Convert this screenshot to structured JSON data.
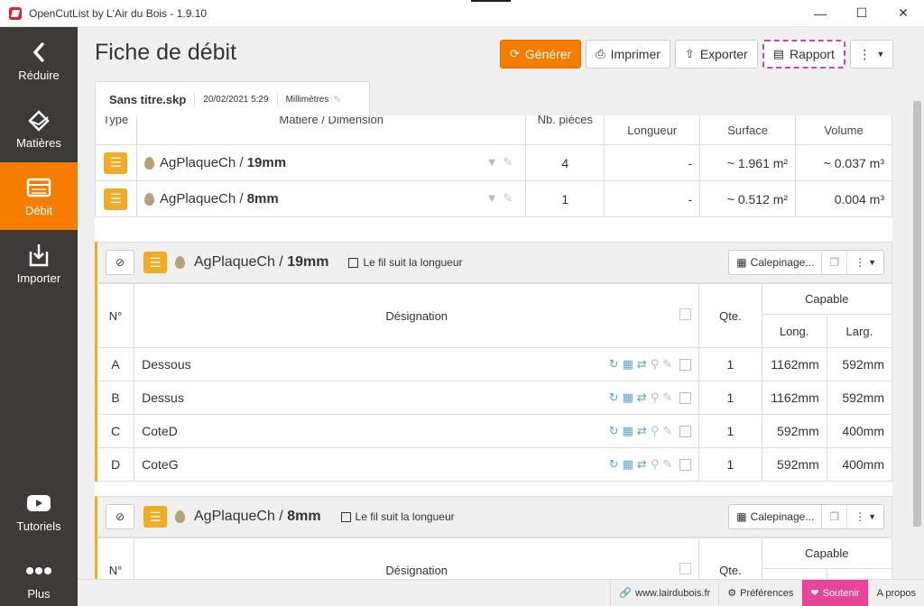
{
  "window": {
    "title": "OpenCutList by L'Air du Bois - 1.9.10"
  },
  "sidebar": {
    "items": [
      {
        "label": "Réduire"
      },
      {
        "label": "Matières"
      },
      {
        "label": "Débit"
      },
      {
        "label": "Importer"
      },
      {
        "label": "Tutoriels"
      },
      {
        "label": "Plus"
      }
    ]
  },
  "header": {
    "title": "Fiche de débit",
    "buttons": {
      "generate": "Générer",
      "print": "Imprimer",
      "export": "Exporter",
      "report": "Rapport"
    }
  },
  "file": {
    "name": "Sans titre.skp",
    "date": "20/02/2021 5:29",
    "units": "Millimètres"
  },
  "summary": {
    "headers": {
      "type": "Type",
      "material": "Matière / Dimension",
      "count": "Nb. pièces",
      "length": "Longueur",
      "surface": "Surface",
      "volume": "Volume"
    },
    "rows": [
      {
        "material": "AgPlaqueCh / ",
        "dimension": "19mm",
        "count": "4",
        "length": "-",
        "surface": "~ 1.961 m²",
        "volume": "~ 0.037 m³"
      },
      {
        "material": "AgPlaqueCh / ",
        "dimension": "8mm",
        "count": "1",
        "length": "-",
        "surface": "~ 0.512 m²",
        "volume": "0.004 m³"
      }
    ]
  },
  "groups": [
    {
      "material": "AgPlaqueCh / ",
      "dimension": "19mm",
      "grain": "Le fil suit la longueur",
      "layout_label": "Calepinage...",
      "headers": {
        "num": "N°",
        "designation": "Désignation",
        "qty": "Qte.",
        "capable": "Capable",
        "long": "Long.",
        "larg": "Larg."
      },
      "parts": [
        {
          "num": "A",
          "name": "Dessous",
          "qty": "1",
          "long": "1162mm",
          "larg": "592mm"
        },
        {
          "num": "B",
          "name": "Dessus",
          "qty": "1",
          "long": "1162mm",
          "larg": "592mm"
        },
        {
          "num": "C",
          "name": "CoteD",
          "qty": "1",
          "long": "592mm",
          "larg": "400mm"
        },
        {
          "num": "D",
          "name": "CoteG",
          "qty": "1",
          "long": "592mm",
          "larg": "400mm"
        }
      ]
    },
    {
      "material": "AgPlaqueCh / ",
      "dimension": "8mm",
      "grain": "Le fil suit la longueur",
      "layout_label": "Calepinage...",
      "headers": {
        "num": "N°",
        "designation": "Désignation",
        "qty": "Qte.",
        "capable": "Capable"
      }
    }
  ],
  "footer": {
    "website": "www.lairdubois.fr",
    "preferences": "Préférences",
    "support": "Soutenir",
    "about": "A propos"
  }
}
